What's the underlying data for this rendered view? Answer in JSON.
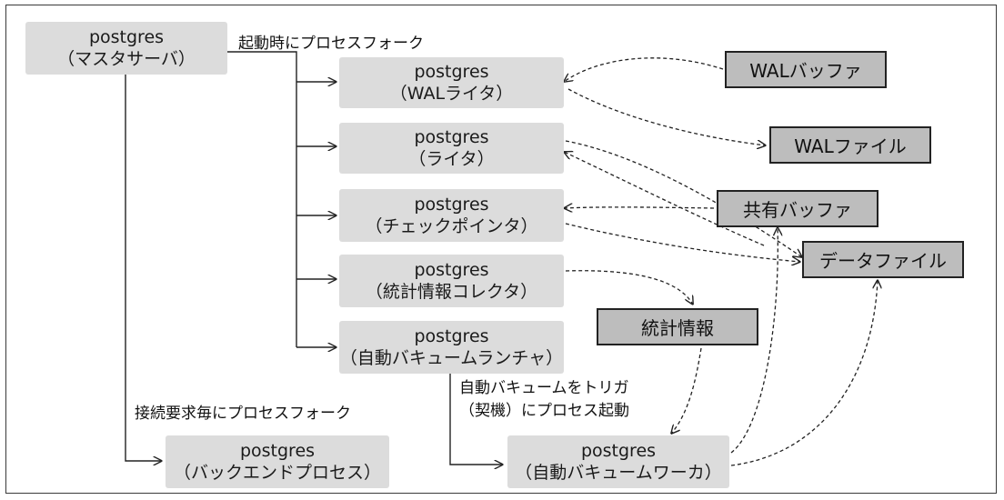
{
  "processes": {
    "master": {
      "name": "postgres",
      "role": "（マスタサーバ）"
    },
    "wal_writer": {
      "name": "postgres",
      "role": "（WALライタ）"
    },
    "writer": {
      "name": "postgres",
      "role": "（ライタ）"
    },
    "checkpointer": {
      "name": "postgres",
      "role": "（チェックポインタ）"
    },
    "stats_collector": {
      "name": "postgres",
      "role": "（統計情報コレクタ）"
    },
    "autovacuum_launcher": {
      "name": "postgres",
      "role": "（自動バキュームランチャ）"
    },
    "backend": {
      "name": "postgres",
      "role": "（バックエンドプロセス）"
    },
    "autovacuum_worker": {
      "name": "postgres",
      "role": "（自動バキュームワーカ）"
    }
  },
  "resources": {
    "wal_buffer": "WALバッファ",
    "wal_file": "WALファイル",
    "shared_buffer": "共有バッファ",
    "data_file": "データファイル",
    "stats": "統計情報"
  },
  "labels": {
    "startup_fork": "起動時にプロセスフォーク",
    "connection_fork": "接続要求毎にプロセスフォーク",
    "trigger_line1": "自動バキュームをトリガ",
    "trigger_line2": "（契機）にプロセス起動"
  },
  "colors": {
    "process_fill": "#dcdcdc",
    "resource_fill": "#bdbdbd",
    "line": "#222222"
  }
}
